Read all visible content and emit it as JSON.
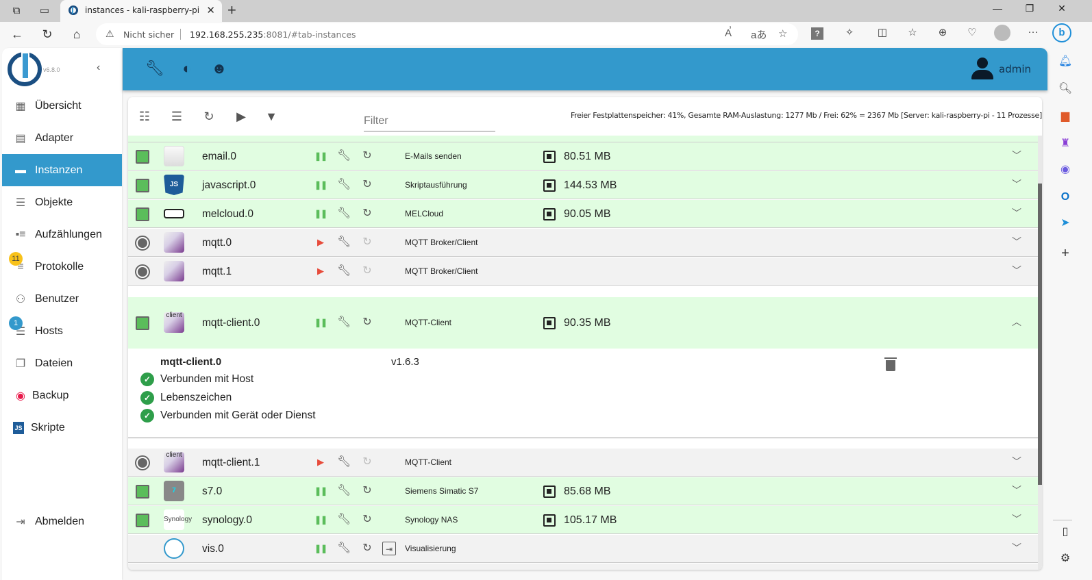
{
  "browser": {
    "tab_title": "instances - kali-raspberry-pi",
    "security_label": "Nicht sicher",
    "url_host": "192.168.255.235",
    "url_rest": ":8081/#tab-instances"
  },
  "app": {
    "version": "v6.8.0",
    "user": "admin"
  },
  "sidebar": {
    "items": [
      {
        "label": "Übersicht",
        "icon": "grid-icon"
      },
      {
        "label": "Adapter",
        "icon": "store-icon"
      },
      {
        "label": "Instanzen",
        "icon": "instances-icon",
        "active": true
      },
      {
        "label": "Objekte",
        "icon": "list-icon"
      },
      {
        "label": "Aufzählungen",
        "icon": "enum-icon"
      },
      {
        "label": "Protokolle",
        "icon": "log-icon",
        "badge": "11"
      },
      {
        "label": "Benutzer",
        "icon": "user-icon"
      },
      {
        "label": "Hosts",
        "icon": "hosts-icon",
        "badge": "1"
      },
      {
        "label": "Dateien",
        "icon": "files-icon"
      },
      {
        "label": "Backup",
        "icon": "backup-icon"
      },
      {
        "label": "Skripte",
        "icon": "js-icon"
      }
    ],
    "logout": "Abmelden"
  },
  "toolbar": {
    "filter_placeholder": "Filter",
    "sysinfo": "Freier Festplattenspeicher: 41%, Gesamte RAM-Auslastung: 1277 Mb / Frei: 62% = 2367 Mb [Server: kali-raspberry-pi - 11 Prozesse]"
  },
  "instances": [
    {
      "name": "email.0",
      "desc": "E-Mails senden",
      "mem": "80.51 MB",
      "state": "running"
    },
    {
      "name": "javascript.0",
      "desc": "Skriptausführung",
      "mem": "144.53 MB",
      "state": "running"
    },
    {
      "name": "melcloud.0",
      "desc": "MELCloud",
      "mem": "90.05 MB",
      "state": "running"
    },
    {
      "name": "mqtt.0",
      "desc": "MQTT Broker/Client",
      "mem": "",
      "state": "stopped"
    },
    {
      "name": "mqtt.1",
      "desc": "MQTT Broker/Client",
      "mem": "",
      "state": "stopped"
    },
    {
      "name": "mqtt-client.0",
      "desc": "MQTT-Client",
      "mem": "90.35 MB",
      "state": "running",
      "expanded": true
    },
    {
      "name": "mqtt-client.1",
      "desc": "MQTT-Client",
      "mem": "",
      "state": "stopped"
    },
    {
      "name": "s7.0",
      "desc": "Siemens Simatic S7",
      "mem": "85.68 MB",
      "state": "running"
    },
    {
      "name": "synology.0",
      "desc": "Synology NAS",
      "mem": "105.17 MB",
      "state": "running"
    },
    {
      "name": "vis.0",
      "desc": "Visualisierung",
      "mem": "",
      "state": "web"
    }
  ],
  "detail": {
    "name": "mqtt-client.0",
    "version": "v1.6.3",
    "statuses": [
      "Verbunden mit Host",
      "Lebenszeichen",
      "Verbunden mit Gerät oder Dienst"
    ]
  },
  "icons": {
    "email": "✉",
    "js": "JS",
    "client": "client",
    "synology": "Synology",
    "s7": "7"
  }
}
